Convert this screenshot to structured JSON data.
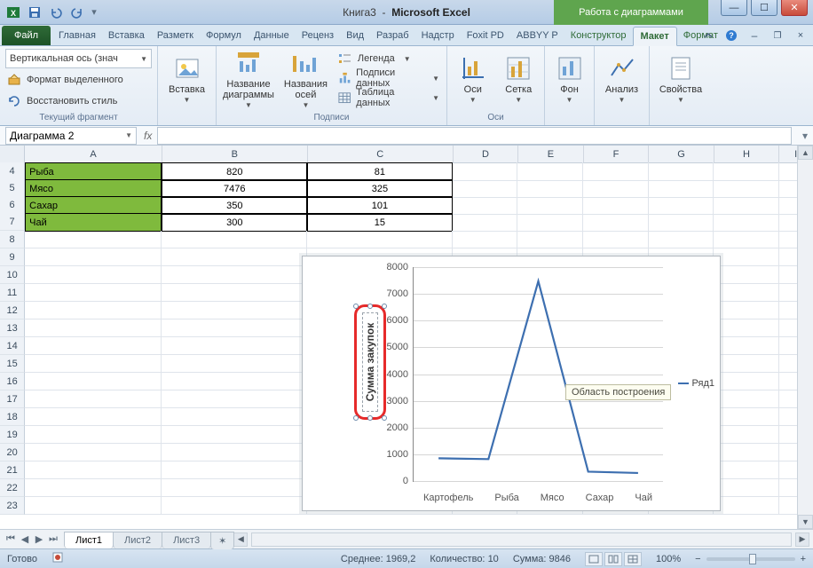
{
  "window": {
    "title_doc": "Книга3",
    "title_app": "Microsoft Excel",
    "context_tab_title": "Работа с диаграммами"
  },
  "qat_icons": [
    "excel",
    "save",
    "undo",
    "redo"
  ],
  "tabs": {
    "file": "Файл",
    "list": [
      "Главная",
      "Вставка",
      "Разметк",
      "Формул",
      "Данные",
      "Реценз",
      "Вид",
      "Разраб",
      "Надстр",
      "Foxit PD",
      "ABBYY P"
    ],
    "ctx": [
      "Конструктор",
      "Макет",
      "Формат"
    ],
    "active": "Макет"
  },
  "ribbon": {
    "g1": {
      "label": "Текущий фрагмент",
      "selector": "Вертикальная ось (знач",
      "format_sel": "Формат выделенного",
      "reset": "Восстановить стиль"
    },
    "g2": {
      "label": "",
      "insert": "Вставка"
    },
    "g3": {
      "label": "Подписи",
      "chart_title": "Название\nдиаграммы",
      "axis_titles": "Названия\nосей",
      "legend": "Легенда",
      "data_labels": "Подписи данных",
      "data_table": "Таблица данных"
    },
    "g4": {
      "label": "Оси",
      "axes": "Оси",
      "grid": "Сетка"
    },
    "g5": {
      "label": "",
      "bg": "Фон"
    },
    "g6": {
      "label": "",
      "analysis": "Анализ"
    },
    "g7": {
      "label": "",
      "props": "Свойства"
    }
  },
  "formula_bar": {
    "name_box": "Диаграмма 2",
    "fx": "fx"
  },
  "columns": [
    "A",
    "B",
    "C",
    "D",
    "E",
    "F",
    "G",
    "H",
    "I"
  ],
  "rows_shown": [
    4,
    5,
    6,
    7,
    8,
    9,
    10,
    11,
    12,
    13,
    14,
    15,
    16,
    17,
    18,
    19,
    20,
    21,
    22,
    23
  ],
  "table": [
    {
      "a": "Рыба",
      "b": "820",
      "c": "81"
    },
    {
      "a": "Мясо",
      "b": "7476",
      "c": "325"
    },
    {
      "a": "Сахар",
      "b": "350",
      "c": "101"
    },
    {
      "a": "Чай",
      "b": "300",
      "c": "15"
    }
  ],
  "chart_data": {
    "type": "line",
    "categories": [
      "Картофель",
      "Рыба",
      "Мясо",
      "Сахар",
      "Чай"
    ],
    "series": [
      {
        "name": "Ряд1",
        "values": [
          850,
          820,
          7476,
          350,
          300
        ]
      }
    ],
    "y_ticks": [
      0,
      1000,
      2000,
      3000,
      4000,
      5000,
      6000,
      7000,
      8000
    ],
    "ylim": [
      0,
      8000
    ],
    "y_axis_title": "Сумма закупок",
    "tooltip": "Область построения",
    "legend_position": "right"
  },
  "sheet_tabs": {
    "active": "Лист1",
    "others": [
      "Лист2",
      "Лист3"
    ]
  },
  "status": {
    "ready": "Готово",
    "avg_label": "Среднее:",
    "avg_val": "1969,2",
    "cnt_label": "Количество:",
    "cnt_val": "10",
    "sum_label": "Сумма:",
    "sum_val": "9846",
    "zoom": "100%"
  }
}
